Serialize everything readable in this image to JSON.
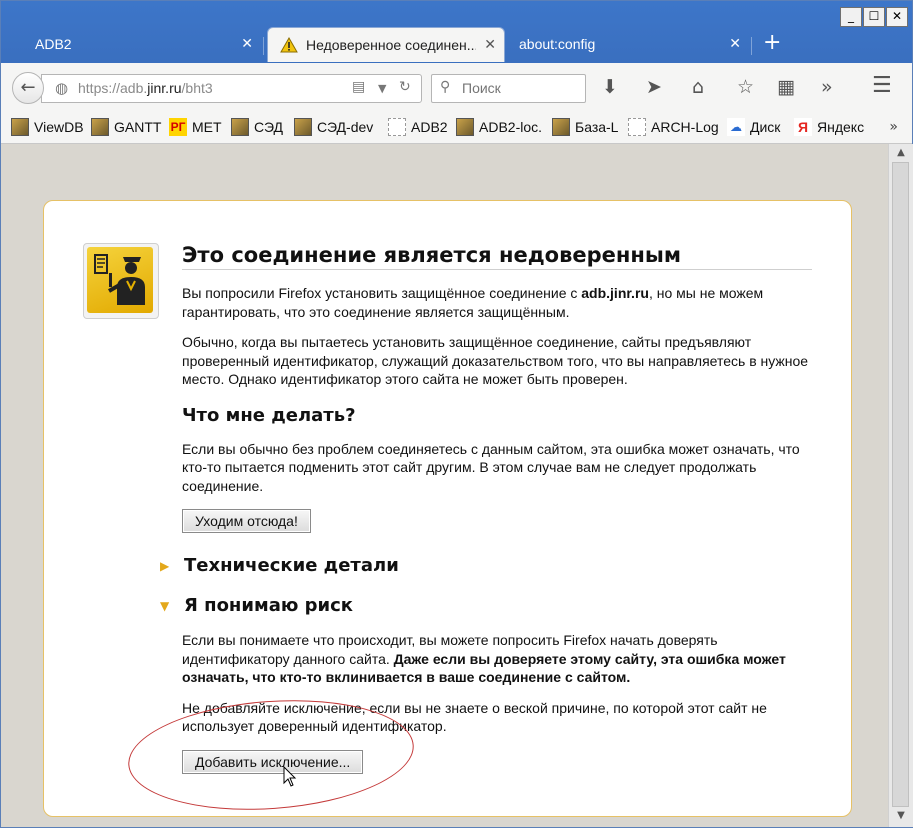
{
  "tabs": [
    {
      "label": "ADB2",
      "active": false
    },
    {
      "label": "Недоверенное соединен...",
      "active": true
    },
    {
      "label": "about:config",
      "active": false
    }
  ],
  "window_controls": {
    "minimize": "_",
    "maximize": "☐",
    "close": "✕"
  },
  "navbar": {
    "url_prefix": "https://adb.",
    "url_domain": "jinr.ru",
    "url_path": "/bht3",
    "search_placeholder": "Поиск"
  },
  "bookmarks": [
    {
      "label": "ViewDB",
      "icon": "pic"
    },
    {
      "label": "GANTT",
      "icon": "pic"
    },
    {
      "label": "MET",
      "icon": "rg"
    },
    {
      "label": "СЭД",
      "icon": "pic"
    },
    {
      "label": "СЭД-dev",
      "icon": "pic"
    },
    {
      "label": "ADB2",
      "icon": "empty"
    },
    {
      "label": "ADB2-loc.",
      "icon": "pic"
    },
    {
      "label": "База-L",
      "icon": "pic"
    },
    {
      "label": "ARCH-Log",
      "icon": "empty"
    },
    {
      "label": "Диск",
      "icon": "disk"
    },
    {
      "label": "Яндекс",
      "icon": "ya"
    }
  ],
  "error": {
    "title": "Это соединение является недоверенным",
    "p1_pre": "Вы попросили Firefox установить защищённое соединение с ",
    "p1_host": "adb.jinr.ru",
    "p1_post": ", но мы не можем гарантировать, что это соединение является защищённым.",
    "p2": "Обычно, когда вы пытаетесь установить защищённое соединение, сайты предъявляют проверенный идентификатор, служащий доказательством того, что вы направляетесь в нужное место. Однако идентификатор этого сайта не может быть проверен.",
    "what_title": "Что мне делать?",
    "p3": "Если вы обычно без проблем соединяетесь с данным сайтом, эта ошибка может означать, что кто-то пытается подменить этот сайт другим. В этом случае вам не следует продолжать соединение.",
    "get_out_button": "Уходим отсюда!",
    "tech_details": "Технические детали",
    "understand_risk": "Я понимаю риск",
    "p4_pre": "Если вы понимаете что происходит, вы можете попросить Firefox начать доверять идентификатору данного сайта. ",
    "p4_bold": "Даже если вы доверяете этому сайту, эта ошибка может означать, что кто-то вклинивается в ваше соединение с сайтом.",
    "p5": "Не добавляйте исключение, если вы не знаете о веской причине, по которой этот сайт не использует доверенный идентификатор.",
    "add_exception_button": "Добавить исключение..."
  },
  "colors": {
    "accent": "#3d76c9",
    "warning_border": "#e6c166",
    "annotation": "#c43a3a"
  }
}
